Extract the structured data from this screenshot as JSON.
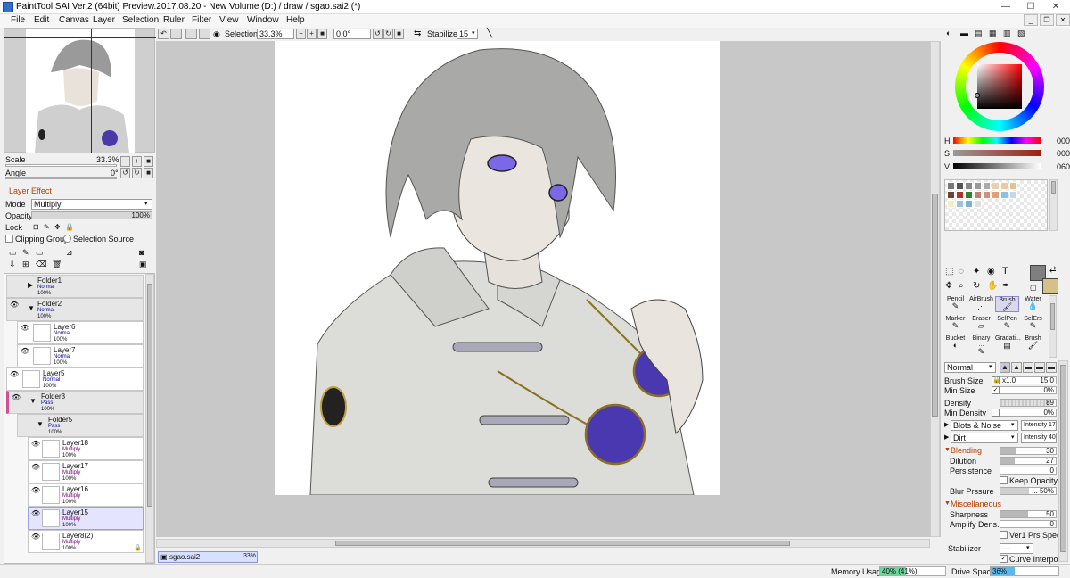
{
  "window": {
    "title": "PaintTool SAI Ver.2 (64bit) Preview.2017.08.20 - New Volume (D:) / draw / sgao.sai2 (*)",
    "minimize": "—",
    "maximize": "☐",
    "close": "✕"
  },
  "menu": [
    "File",
    "Edit",
    "Canvas",
    "Layer",
    "Selection",
    "Ruler",
    "Filter",
    "View",
    "Window",
    "Help"
  ],
  "toolbar": {
    "selection_label": "Selection",
    "zoom": "33.3%",
    "angle": "0.0°",
    "stabilizer_label": "Stabilizer",
    "stabilizer_value": "15"
  },
  "navigator": {
    "scale_label": "Scale",
    "scale_value": "33.3%",
    "angle_label": "Angle",
    "angle_value": "0°"
  },
  "layer_effect": {
    "header": "Layer Effect",
    "mode_label": "Mode",
    "mode_value": "Multiply",
    "opacity_label": "Opacity",
    "opacity_value": "100%",
    "lock_label": "Lock",
    "clipping_label": "Clipping Group",
    "selection_source_label": "Selection Source"
  },
  "layers": [
    {
      "name": "Folder1",
      "mode": "Normal",
      "opacity": "100%",
      "type": "folder"
    },
    {
      "name": "Folder2",
      "mode": "Normal",
      "opacity": "100%",
      "type": "folder"
    },
    {
      "name": "Layer6",
      "mode": "Normal",
      "opacity": "100%",
      "type": "layer"
    },
    {
      "name": "Layer7",
      "mode": "Normal",
      "opacity": "100%",
      "type": "layer"
    },
    {
      "name": "Layer5",
      "mode": "Normal",
      "opacity": "100%",
      "type": "layer"
    },
    {
      "name": "Folder3",
      "mode": "Pass",
      "opacity": "100%",
      "type": "folder"
    },
    {
      "name": "Folder5",
      "mode": "Pass",
      "opacity": "100%",
      "type": "folder"
    },
    {
      "name": "Layer18",
      "mode": "Multiply",
      "opacity": "100%",
      "type": "layer"
    },
    {
      "name": "Layer17",
      "mode": "Multiply",
      "opacity": "100%",
      "type": "layer"
    },
    {
      "name": "Layer16",
      "mode": "Multiply",
      "opacity": "100%",
      "type": "layer"
    },
    {
      "name": "Layer15",
      "mode": "Multiply",
      "opacity": "100%",
      "type": "layer"
    },
    {
      "name": "Layer8(2)",
      "mode": "Multiply",
      "opacity": "100%",
      "type": "layer"
    }
  ],
  "color": {
    "h_label": "H",
    "h_value": "000",
    "s_label": "S",
    "s_value": "000",
    "v_label": "V",
    "v_value": "060"
  },
  "swatches": [
    "#777777",
    "#555555",
    "#888888",
    "#999999",
    "#aaaaaa",
    "#e8d0b0",
    "#f0c8a0",
    "#e8c090",
    "#704030",
    "#b03030",
    "#308030",
    "#c08070",
    "#d09080",
    "#e0a080",
    "#90c0e0",
    "#c0d8f0",
    "#f0f0c0",
    "#a0c0e0",
    "#80b0d0",
    "#e0e0e0"
  ],
  "tools": [
    {
      "name": "Pencil",
      "icon": "✎"
    },
    {
      "name": "AirBrush",
      "icon": "⋰"
    },
    {
      "name": "Brush",
      "icon": "🖌"
    },
    {
      "name": "Water",
      "icon": "💧"
    },
    {
      "name": "Marker",
      "icon": "✎"
    },
    {
      "name": "Eraser",
      "icon": "▱"
    },
    {
      "name": "SelPen",
      "icon": "✎"
    },
    {
      "name": "SelErs",
      "icon": "✎"
    },
    {
      "name": "Bucket",
      "icon": "◐"
    },
    {
      "name": "Binary ...",
      "icon": "✎"
    },
    {
      "name": "Gradati...",
      "icon": "▤"
    },
    {
      "name": "Brush",
      "icon": "🖌"
    }
  ],
  "brush": {
    "mode": "Normal",
    "size_label": "Brush Size",
    "size_mult": "x1.0",
    "size_value": "15.0",
    "min_size_label": "Min Size",
    "min_size_value": "0%",
    "density_label": "Density",
    "density_value": "89",
    "min_density_label": "Min Density",
    "min_density_value": "0%",
    "texture1": "Blots & Noise",
    "intensity1": "Intensity 17",
    "texture2": "Dirt",
    "intensity2": "Intensity 40",
    "blending_header": "Blending",
    "blending_value": "30",
    "dilution_label": "Dilution",
    "dilution_value": "27",
    "persistence_label": "Persistence",
    "persistence_value": "0",
    "keep_opacity_label": "Keep Opacity",
    "blur_label": "Blur Prssure",
    "blur_value": "... 50%",
    "misc_header": "Miscellaneous",
    "sharpness_label": "Sharpness",
    "sharpness_value": "50",
    "amplify_label": "Amplify Dens.",
    "amplify_value": "0",
    "ver1_label": "Ver1 Prs Spec.",
    "stabilizer_label": "Stabilizer",
    "stabilizer_value": "---",
    "curve_label": "Curve Interpo."
  },
  "document_tab": {
    "name": "sgao.sai2",
    "zoom": "33%"
  },
  "status": {
    "memory_label": "Memory Usage",
    "memory_value": "40% (41%)",
    "memory_fraction": 0.4,
    "drive_label": "Drive Space",
    "drive_value": "36%",
    "drive_fraction": 0.36
  }
}
